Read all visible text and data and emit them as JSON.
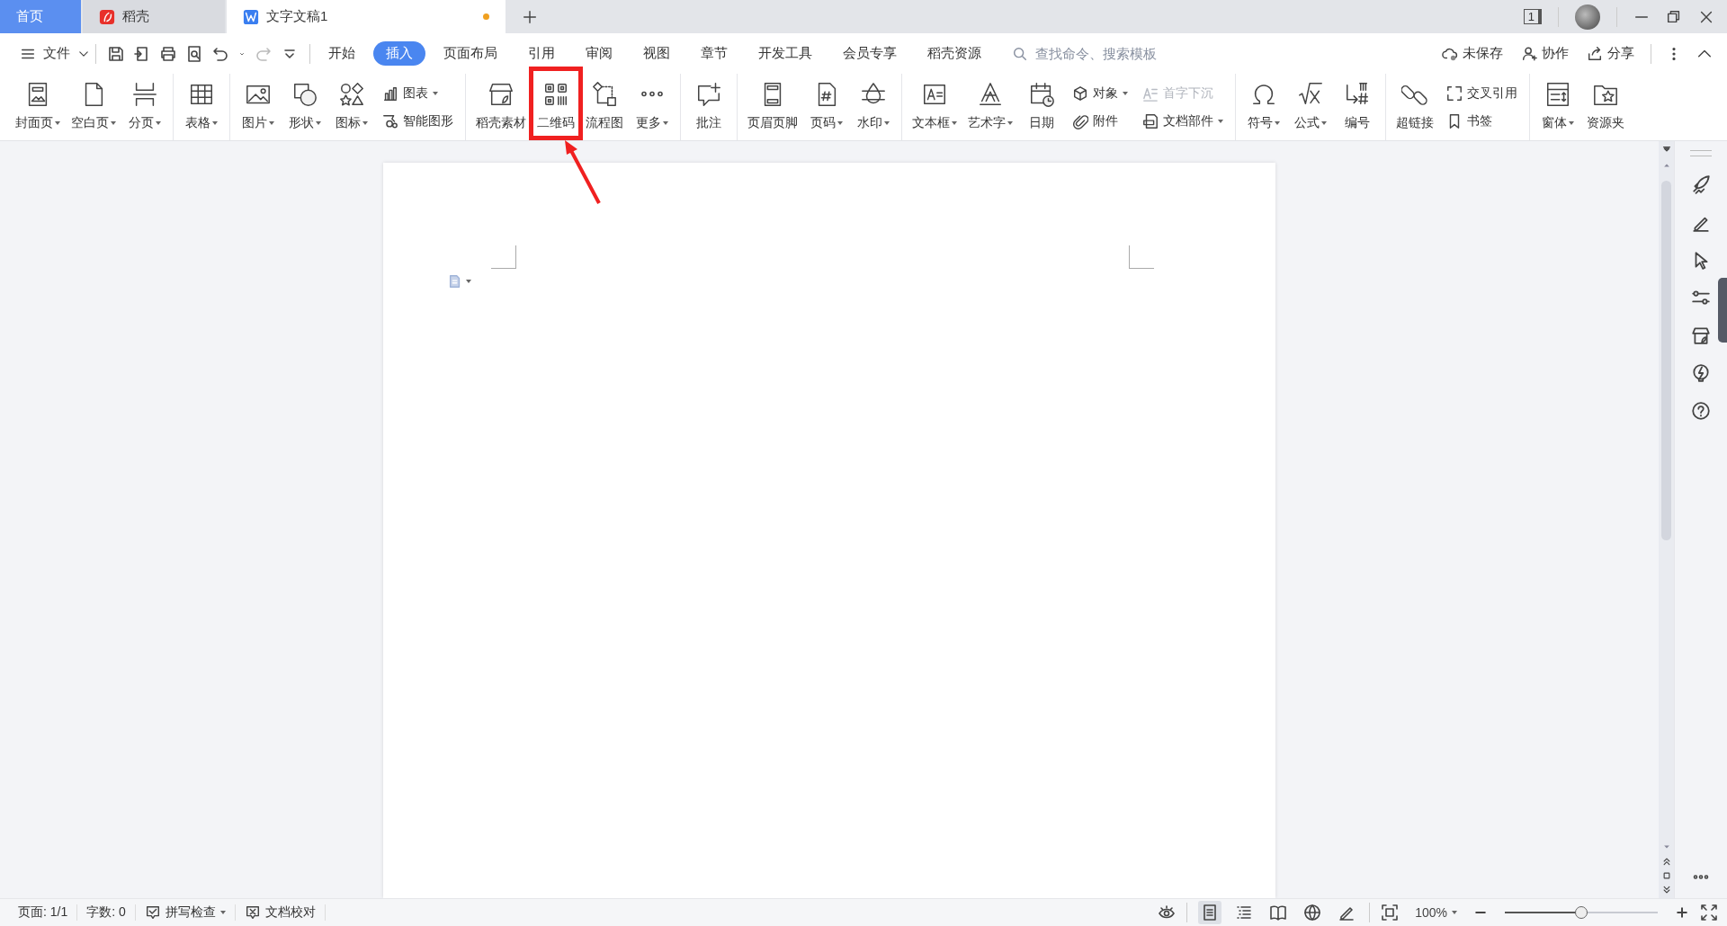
{
  "tabs": [
    {
      "kind": "home",
      "label": "首页",
      "selected": false
    },
    {
      "kind": "app",
      "label": "稻壳",
      "selected": false
    },
    {
      "kind": "doc",
      "label": "文字文稿1",
      "selected": true,
      "modified": true
    }
  ],
  "window_count": "1",
  "menu": {
    "file_label": "文件",
    "ribbon_tabs": [
      {
        "label": "开始",
        "selected": false
      },
      {
        "label": "插入",
        "selected": true
      },
      {
        "label": "页面布局",
        "selected": false
      },
      {
        "label": "引用",
        "selected": false
      },
      {
        "label": "审阅",
        "selected": false
      },
      {
        "label": "视图",
        "selected": false
      },
      {
        "label": "章节",
        "selected": false
      },
      {
        "label": "开发工具",
        "selected": false
      },
      {
        "label": "会员专享",
        "selected": false
      },
      {
        "label": "稻壳资源",
        "selected": false
      }
    ],
    "search": {
      "placeholder": "查找命令、搜索模板"
    },
    "actions": [
      {
        "label": "未保存"
      },
      {
        "label": "协作"
      },
      {
        "label": "分享"
      }
    ]
  },
  "ribbon": {
    "groups": [
      {
        "items": [
          {
            "kind": "large",
            "label": "封面页",
            "dropdown": true,
            "highlighted": false
          },
          {
            "kind": "large",
            "label": "空白页",
            "dropdown": true,
            "highlighted": false
          },
          {
            "kind": "large",
            "label": "分页",
            "dropdown": true,
            "highlighted": false
          }
        ]
      },
      {
        "items": [
          {
            "kind": "large",
            "label": "表格",
            "dropdown": true,
            "highlighted": false
          }
        ]
      },
      {
        "items": [
          {
            "kind": "large",
            "label": "图片",
            "dropdown": true,
            "highlighted": false
          },
          {
            "kind": "large",
            "label": "形状",
            "dropdown": true,
            "highlighted": false
          },
          {
            "kind": "large",
            "label": "图标",
            "dropdown": true,
            "highlighted": false
          },
          {
            "kind": "stack",
            "items": [
              {
                "label": "图表",
                "dropdown": true,
                "disabled": false
              },
              {
                "label": "智能图形",
                "dropdown": false,
                "disabled": false
              }
            ]
          }
        ]
      },
      {
        "items": [
          {
            "kind": "large",
            "label": "稻壳素材",
            "dropdown": false,
            "highlighted": false
          },
          {
            "kind": "large",
            "label": "二维码",
            "dropdown": false,
            "highlighted": true
          },
          {
            "kind": "large",
            "label": "流程图",
            "dropdown": false,
            "highlighted": false
          },
          {
            "kind": "large",
            "label": "更多",
            "dropdown": true,
            "highlighted": false
          }
        ]
      },
      {
        "items": [
          {
            "kind": "large",
            "label": "批注",
            "dropdown": false,
            "highlighted": false
          }
        ]
      },
      {
        "items": [
          {
            "kind": "large",
            "label": "页眉页脚",
            "dropdown": false,
            "highlighted": false
          },
          {
            "kind": "large",
            "label": "页码",
            "dropdown": true,
            "highlighted": false
          },
          {
            "kind": "large",
            "label": "水印",
            "dropdown": true,
            "highlighted": false
          }
        ]
      },
      {
        "items": [
          {
            "kind": "large",
            "label": "文本框",
            "dropdown": true,
            "highlighted": false
          },
          {
            "kind": "large",
            "label": "艺术字",
            "dropdown": true,
            "highlighted": false
          },
          {
            "kind": "large",
            "label": "日期",
            "dropdown": false,
            "highlighted": false
          },
          {
            "kind": "stack",
            "items": [
              {
                "label": "对象",
                "dropdown": true,
                "disabled": false
              },
              {
                "label": "附件",
                "dropdown": false,
                "disabled": false
              }
            ]
          },
          {
            "kind": "stack",
            "items": [
              {
                "label": "首字下沉",
                "dropdown": false,
                "disabled": true
              },
              {
                "label": "文档部件",
                "dropdown": true,
                "disabled": false
              }
            ]
          }
        ]
      },
      {
        "items": [
          {
            "kind": "large",
            "label": "符号",
            "dropdown": true,
            "highlighted": false
          },
          {
            "kind": "large",
            "label": "公式",
            "dropdown": true,
            "highlighted": false
          },
          {
            "kind": "large",
            "label": "编号",
            "dropdown": false,
            "highlighted": false
          }
        ]
      },
      {
        "items": [
          {
            "kind": "large",
            "label": "超链接",
            "dropdown": false,
            "highlighted": false
          },
          {
            "kind": "stack",
            "items": [
              {
                "label": "交叉引用",
                "dropdown": false,
                "disabled": false
              },
              {
                "label": "书签",
                "dropdown": false,
                "disabled": false
              }
            ]
          }
        ]
      },
      {
        "items": [
          {
            "kind": "large",
            "label": "窗体",
            "dropdown": true,
            "highlighted": false
          },
          {
            "kind": "large",
            "label": "资源夹",
            "dropdown": false,
            "highlighted": false
          }
        ]
      }
    ]
  },
  "status_bar": {
    "left": [
      {
        "kind": "text",
        "label": "页面: 1/1",
        "dropdown": false
      },
      {
        "kind": "text",
        "label": "字数: 0",
        "dropdown": false
      },
      {
        "kind": "check",
        "label": "拼写检查",
        "dropdown": true
      },
      {
        "kind": "proof",
        "label": "文档校对",
        "dropdown": false
      }
    ],
    "view_modes": [
      {
        "selected": true
      },
      {
        "selected": false
      },
      {
        "selected": false
      },
      {
        "selected": false
      },
      {
        "selected": false
      }
    ],
    "zoom": "100%",
    "zoom_slider": {
      "level": 0.5
    }
  }
}
